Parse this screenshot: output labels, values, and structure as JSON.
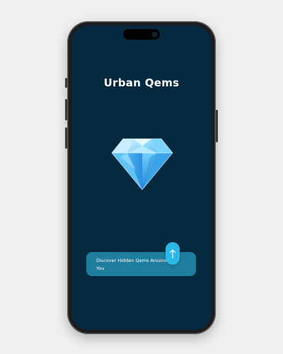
{
  "app": {
    "title": "Urban Qems"
  },
  "cta": {
    "text": "Discover Hidden Qems Around You"
  },
  "icons": {
    "hero": "diamond-gem-icon",
    "swipe": "arrow-up-icon"
  },
  "colors": {
    "screen_background": "#052a40",
    "cta_background": "#1f7d9e",
    "cta_knob": "#2ab8e6",
    "page_background": "#efefef"
  }
}
